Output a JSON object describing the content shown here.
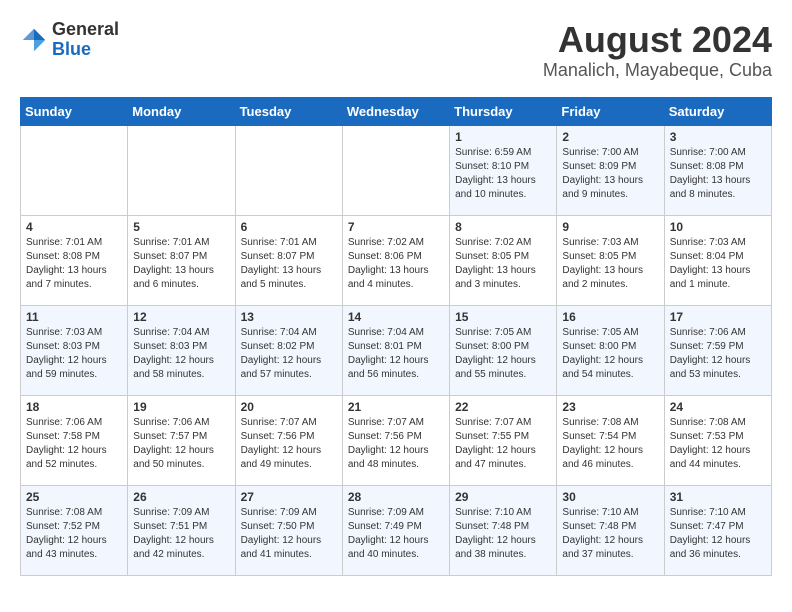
{
  "header": {
    "logo_general": "General",
    "logo_blue": "Blue",
    "title": "August 2024",
    "subtitle": "Manalich, Mayabeque, Cuba"
  },
  "calendar": {
    "days_of_week": [
      "Sunday",
      "Monday",
      "Tuesday",
      "Wednesday",
      "Thursday",
      "Friday",
      "Saturday"
    ],
    "weeks": [
      [
        {
          "num": "",
          "info": ""
        },
        {
          "num": "",
          "info": ""
        },
        {
          "num": "",
          "info": ""
        },
        {
          "num": "",
          "info": ""
        },
        {
          "num": "1",
          "info": "Sunrise: 6:59 AM\nSunset: 8:10 PM\nDaylight: 13 hours\nand 10 minutes."
        },
        {
          "num": "2",
          "info": "Sunrise: 7:00 AM\nSunset: 8:09 PM\nDaylight: 13 hours\nand 9 minutes."
        },
        {
          "num": "3",
          "info": "Sunrise: 7:00 AM\nSunset: 8:08 PM\nDaylight: 13 hours\nand 8 minutes."
        }
      ],
      [
        {
          "num": "4",
          "info": "Sunrise: 7:01 AM\nSunset: 8:08 PM\nDaylight: 13 hours\nand 7 minutes."
        },
        {
          "num": "5",
          "info": "Sunrise: 7:01 AM\nSunset: 8:07 PM\nDaylight: 13 hours\nand 6 minutes."
        },
        {
          "num": "6",
          "info": "Sunrise: 7:01 AM\nSunset: 8:07 PM\nDaylight: 13 hours\nand 5 minutes."
        },
        {
          "num": "7",
          "info": "Sunrise: 7:02 AM\nSunset: 8:06 PM\nDaylight: 13 hours\nand 4 minutes."
        },
        {
          "num": "8",
          "info": "Sunrise: 7:02 AM\nSunset: 8:05 PM\nDaylight: 13 hours\nand 3 minutes."
        },
        {
          "num": "9",
          "info": "Sunrise: 7:03 AM\nSunset: 8:05 PM\nDaylight: 13 hours\nand 2 minutes."
        },
        {
          "num": "10",
          "info": "Sunrise: 7:03 AM\nSunset: 8:04 PM\nDaylight: 13 hours\nand 1 minute."
        }
      ],
      [
        {
          "num": "11",
          "info": "Sunrise: 7:03 AM\nSunset: 8:03 PM\nDaylight: 12 hours\nand 59 minutes."
        },
        {
          "num": "12",
          "info": "Sunrise: 7:04 AM\nSunset: 8:03 PM\nDaylight: 12 hours\nand 58 minutes."
        },
        {
          "num": "13",
          "info": "Sunrise: 7:04 AM\nSunset: 8:02 PM\nDaylight: 12 hours\nand 57 minutes."
        },
        {
          "num": "14",
          "info": "Sunrise: 7:04 AM\nSunset: 8:01 PM\nDaylight: 12 hours\nand 56 minutes."
        },
        {
          "num": "15",
          "info": "Sunrise: 7:05 AM\nSunset: 8:00 PM\nDaylight: 12 hours\nand 55 minutes."
        },
        {
          "num": "16",
          "info": "Sunrise: 7:05 AM\nSunset: 8:00 PM\nDaylight: 12 hours\nand 54 minutes."
        },
        {
          "num": "17",
          "info": "Sunrise: 7:06 AM\nSunset: 7:59 PM\nDaylight: 12 hours\nand 53 minutes."
        }
      ],
      [
        {
          "num": "18",
          "info": "Sunrise: 7:06 AM\nSunset: 7:58 PM\nDaylight: 12 hours\nand 52 minutes."
        },
        {
          "num": "19",
          "info": "Sunrise: 7:06 AM\nSunset: 7:57 PM\nDaylight: 12 hours\nand 50 minutes."
        },
        {
          "num": "20",
          "info": "Sunrise: 7:07 AM\nSunset: 7:56 PM\nDaylight: 12 hours\nand 49 minutes."
        },
        {
          "num": "21",
          "info": "Sunrise: 7:07 AM\nSunset: 7:56 PM\nDaylight: 12 hours\nand 48 minutes."
        },
        {
          "num": "22",
          "info": "Sunrise: 7:07 AM\nSunset: 7:55 PM\nDaylight: 12 hours\nand 47 minutes."
        },
        {
          "num": "23",
          "info": "Sunrise: 7:08 AM\nSunset: 7:54 PM\nDaylight: 12 hours\nand 46 minutes."
        },
        {
          "num": "24",
          "info": "Sunrise: 7:08 AM\nSunset: 7:53 PM\nDaylight: 12 hours\nand 44 minutes."
        }
      ],
      [
        {
          "num": "25",
          "info": "Sunrise: 7:08 AM\nSunset: 7:52 PM\nDaylight: 12 hours\nand 43 minutes."
        },
        {
          "num": "26",
          "info": "Sunrise: 7:09 AM\nSunset: 7:51 PM\nDaylight: 12 hours\nand 42 minutes."
        },
        {
          "num": "27",
          "info": "Sunrise: 7:09 AM\nSunset: 7:50 PM\nDaylight: 12 hours\nand 41 minutes."
        },
        {
          "num": "28",
          "info": "Sunrise: 7:09 AM\nSunset: 7:49 PM\nDaylight: 12 hours\nand 40 minutes."
        },
        {
          "num": "29",
          "info": "Sunrise: 7:10 AM\nSunset: 7:48 PM\nDaylight: 12 hours\nand 38 minutes."
        },
        {
          "num": "30",
          "info": "Sunrise: 7:10 AM\nSunset: 7:48 PM\nDaylight: 12 hours\nand 37 minutes."
        },
        {
          "num": "31",
          "info": "Sunrise: 7:10 AM\nSunset: 7:47 PM\nDaylight: 12 hours\nand 36 minutes."
        }
      ]
    ]
  }
}
